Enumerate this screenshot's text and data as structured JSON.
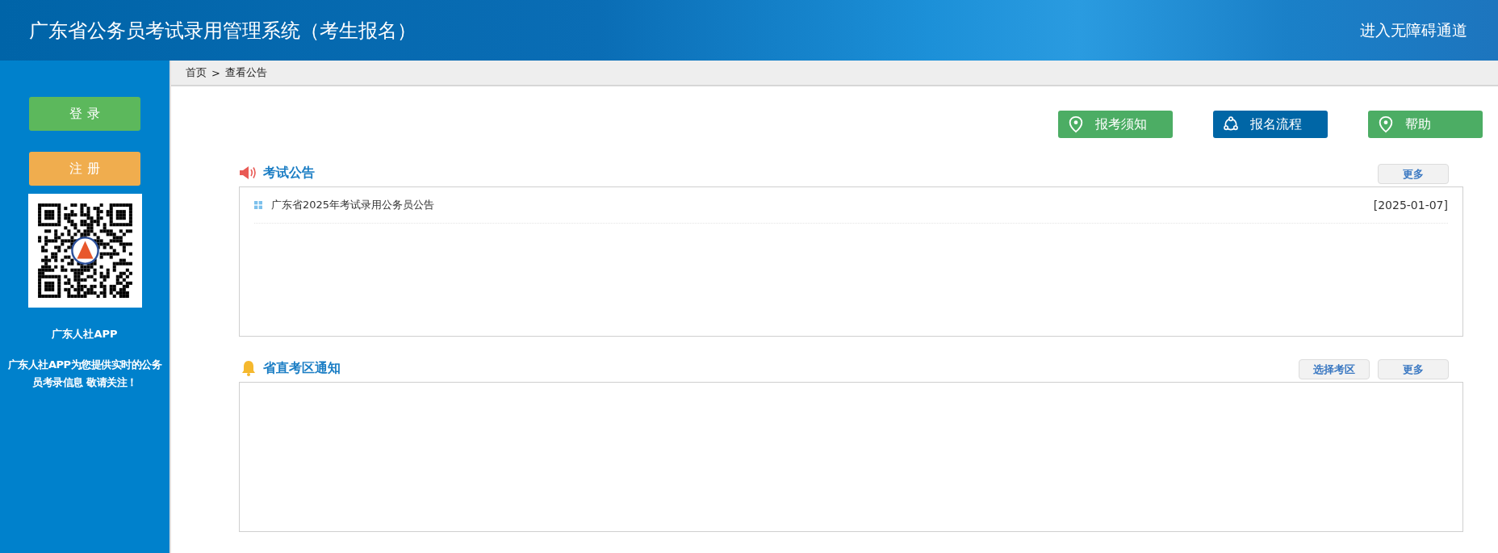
{
  "header": {
    "title": "广东省公务员考试录用管理系统（考生报名）",
    "accessibility_link": "进入无障碍通道"
  },
  "sidebar": {
    "buttons": [
      {
        "label": "登 录",
        "color": "#5cb85c"
      },
      {
        "label": "注 册",
        "color": "#f0ad4e"
      }
    ],
    "app_name": "广东人社APP",
    "app_description": "广东人社APP为您提供实时的公务员考录信息 敬请关注！"
  },
  "breadcrumb": {
    "items": [
      "首页",
      "查看公告"
    ],
    "separator": ">"
  },
  "quick_links": [
    {
      "label": "报考须知",
      "kind": "pin",
      "color": "#4cad64"
    },
    {
      "label": "报名流程",
      "kind": "cycle",
      "color": "#0066a6"
    },
    {
      "label": "帮助",
      "kind": "pin",
      "color": "#4cad64"
    }
  ],
  "sections": [
    {
      "title": "考试公告",
      "kind": "speaker",
      "buttons": [
        "更多"
      ],
      "items": [
        {
          "title": "广东省2025年考试录用公务员公告",
          "date": "[2025-01-07]"
        }
      ]
    },
    {
      "title": "省直考区通知",
      "kind": "bell",
      "buttons": [
        "选择考区",
        "更多"
      ]
    }
  ]
}
